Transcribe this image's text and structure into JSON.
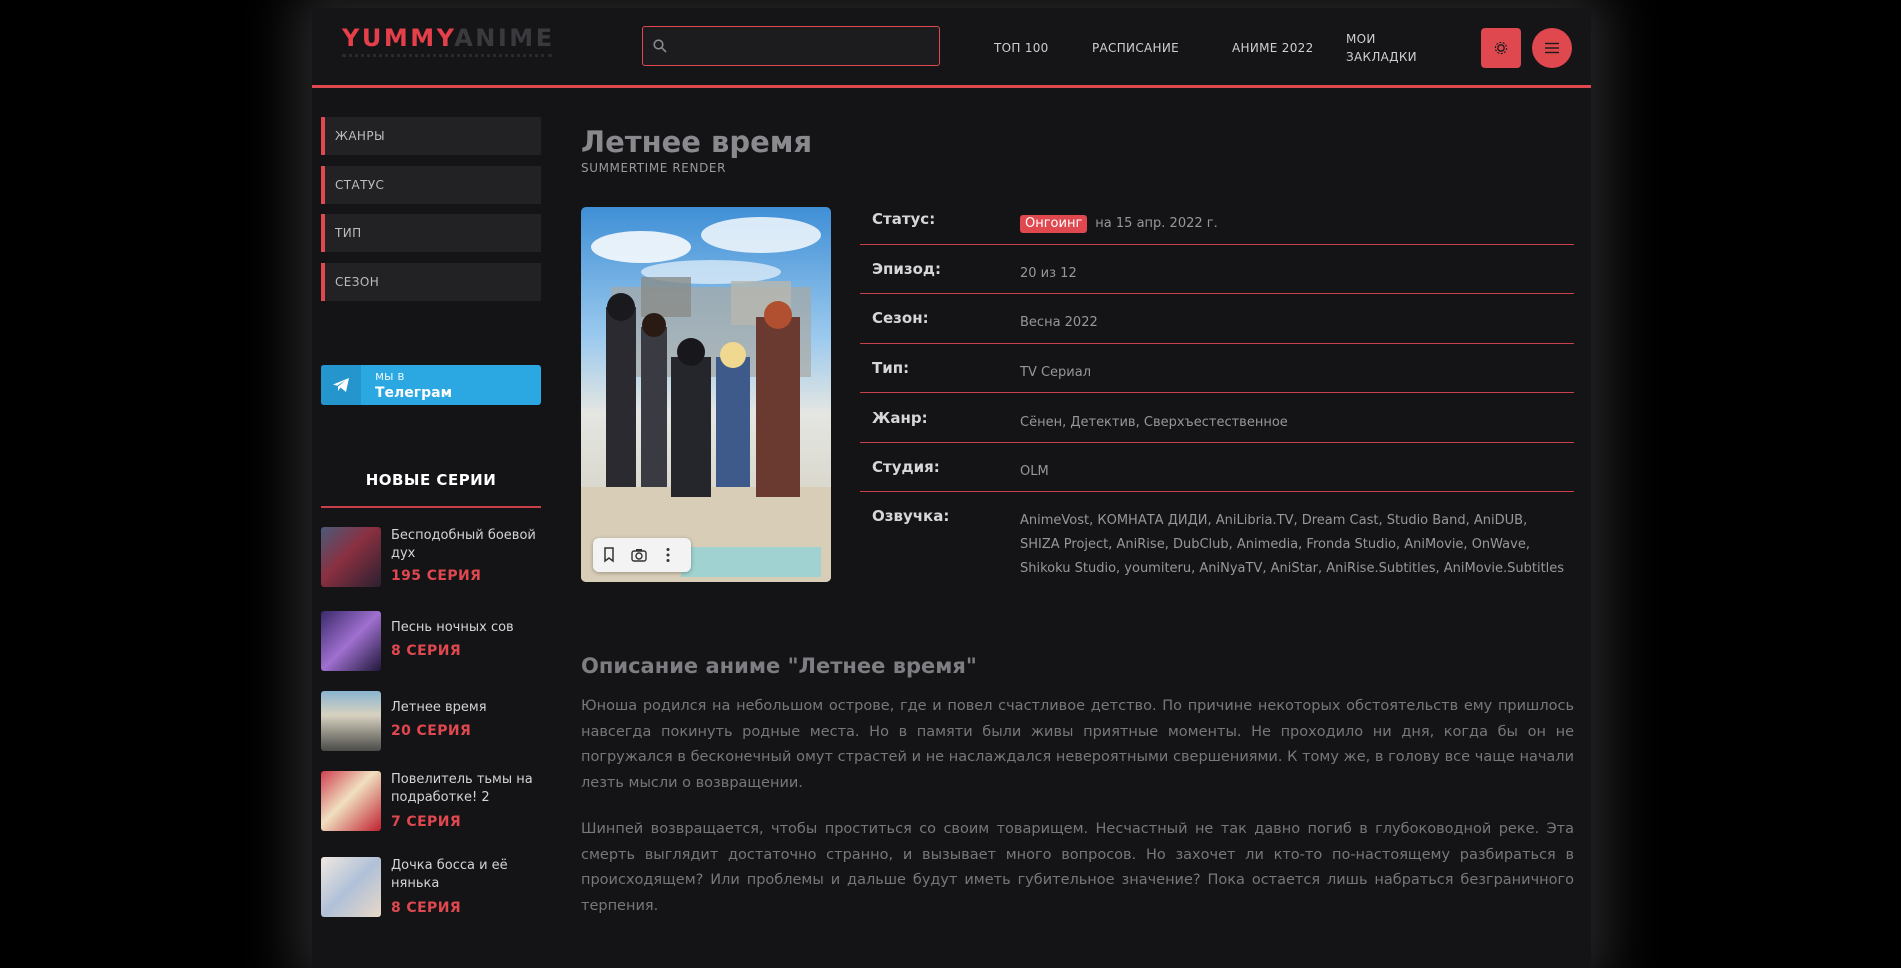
{
  "header": {
    "logo_part1": "YUMMY",
    "logo_part2": "ANIME",
    "search_placeholder": "",
    "nav": [
      "ТОП 100",
      "РАСПИСАНИЕ",
      "АНИМЕ 2022",
      "МОИ ЗАКЛАДКИ"
    ],
    "accent": "#e0484f"
  },
  "sidebar": {
    "filters": [
      "ЖАНРЫ",
      "СТАТУС",
      "ТИП",
      "СЕЗОН"
    ],
    "telegram": {
      "line1": "мы в",
      "line2": "Телеграм",
      "color": "#2ba7e1"
    },
    "new_title": "НОВЫЕ СЕРИИ",
    "episodes": [
      {
        "title": "Бесподобный боевой дух",
        "num": "195 СЕРИЯ"
      },
      {
        "title": "Песнь ночных сов",
        "num": "8 СЕРИЯ"
      },
      {
        "title": "Летнее время",
        "num": "20 СЕРИЯ"
      },
      {
        "title": "Повелитель тьмы на подработке! 2",
        "num": "7 СЕРИЯ"
      },
      {
        "title": "Дочка босса и её нянька",
        "num": "8 СЕРИЯ"
      }
    ]
  },
  "anime": {
    "title": "Летнее время",
    "subtitle": "SUMMERTIME RENDER",
    "info": [
      {
        "label": "Статус:",
        "badge": "Онгоинг",
        "value": "на 15 апр. 2022 г."
      },
      {
        "label": "Эпизод:",
        "value": "20 из 12"
      },
      {
        "label": "Сезон:",
        "value": "Весна 2022"
      },
      {
        "label": "Тип:",
        "value": "TV Сериал"
      },
      {
        "label": "Жанр:",
        "value": "Сёнен, Детектив, Сверхъестественное"
      },
      {
        "label": "Студия:",
        "value": "OLM"
      },
      {
        "label": "Озвучка:",
        "value": "AnimeVost, КОМНАТА ДИДИ, AniLibria.TV, Dream Cast, Studio Band, AniDUB, SHIZA Project, AniRise, DubClub, Animedia, Fronda Studio, AniMovie, OnWave, Shikoku Studio, youmiteru, AniNyaTV, AniStar, AniRise.Subtitles, AniMovie.Subtitles"
      }
    ],
    "description_title": "Описание аниме \"Летнее время\"",
    "description": [
      "Юноша родился на небольшом острове, где и повел счастливое детство. По причине некоторых обстоятельств ему пришлось навсегда покинуть родные места. Но в памяти были живы приятные моменты. Не проходило ни дня, когда бы он не погружался в бесконечный омут страстей и не наслаждался невероятными свершениями. К тому же, в голову все чаще начали лезть мысли о возвращении.",
      "Шинпей возвращается, чтобы проститься со своим товарищем. Несчастный не так давно погиб в глубоководной реке. Эта смерть выглядит достаточно странно, и вызывает много вопросов. Но захочет ли кто-то по-настоящему разбираться в происходящем? Или проблемы и дальше будут иметь губительное значение? Пока остается лишь набраться безграничного терпения."
    ]
  }
}
